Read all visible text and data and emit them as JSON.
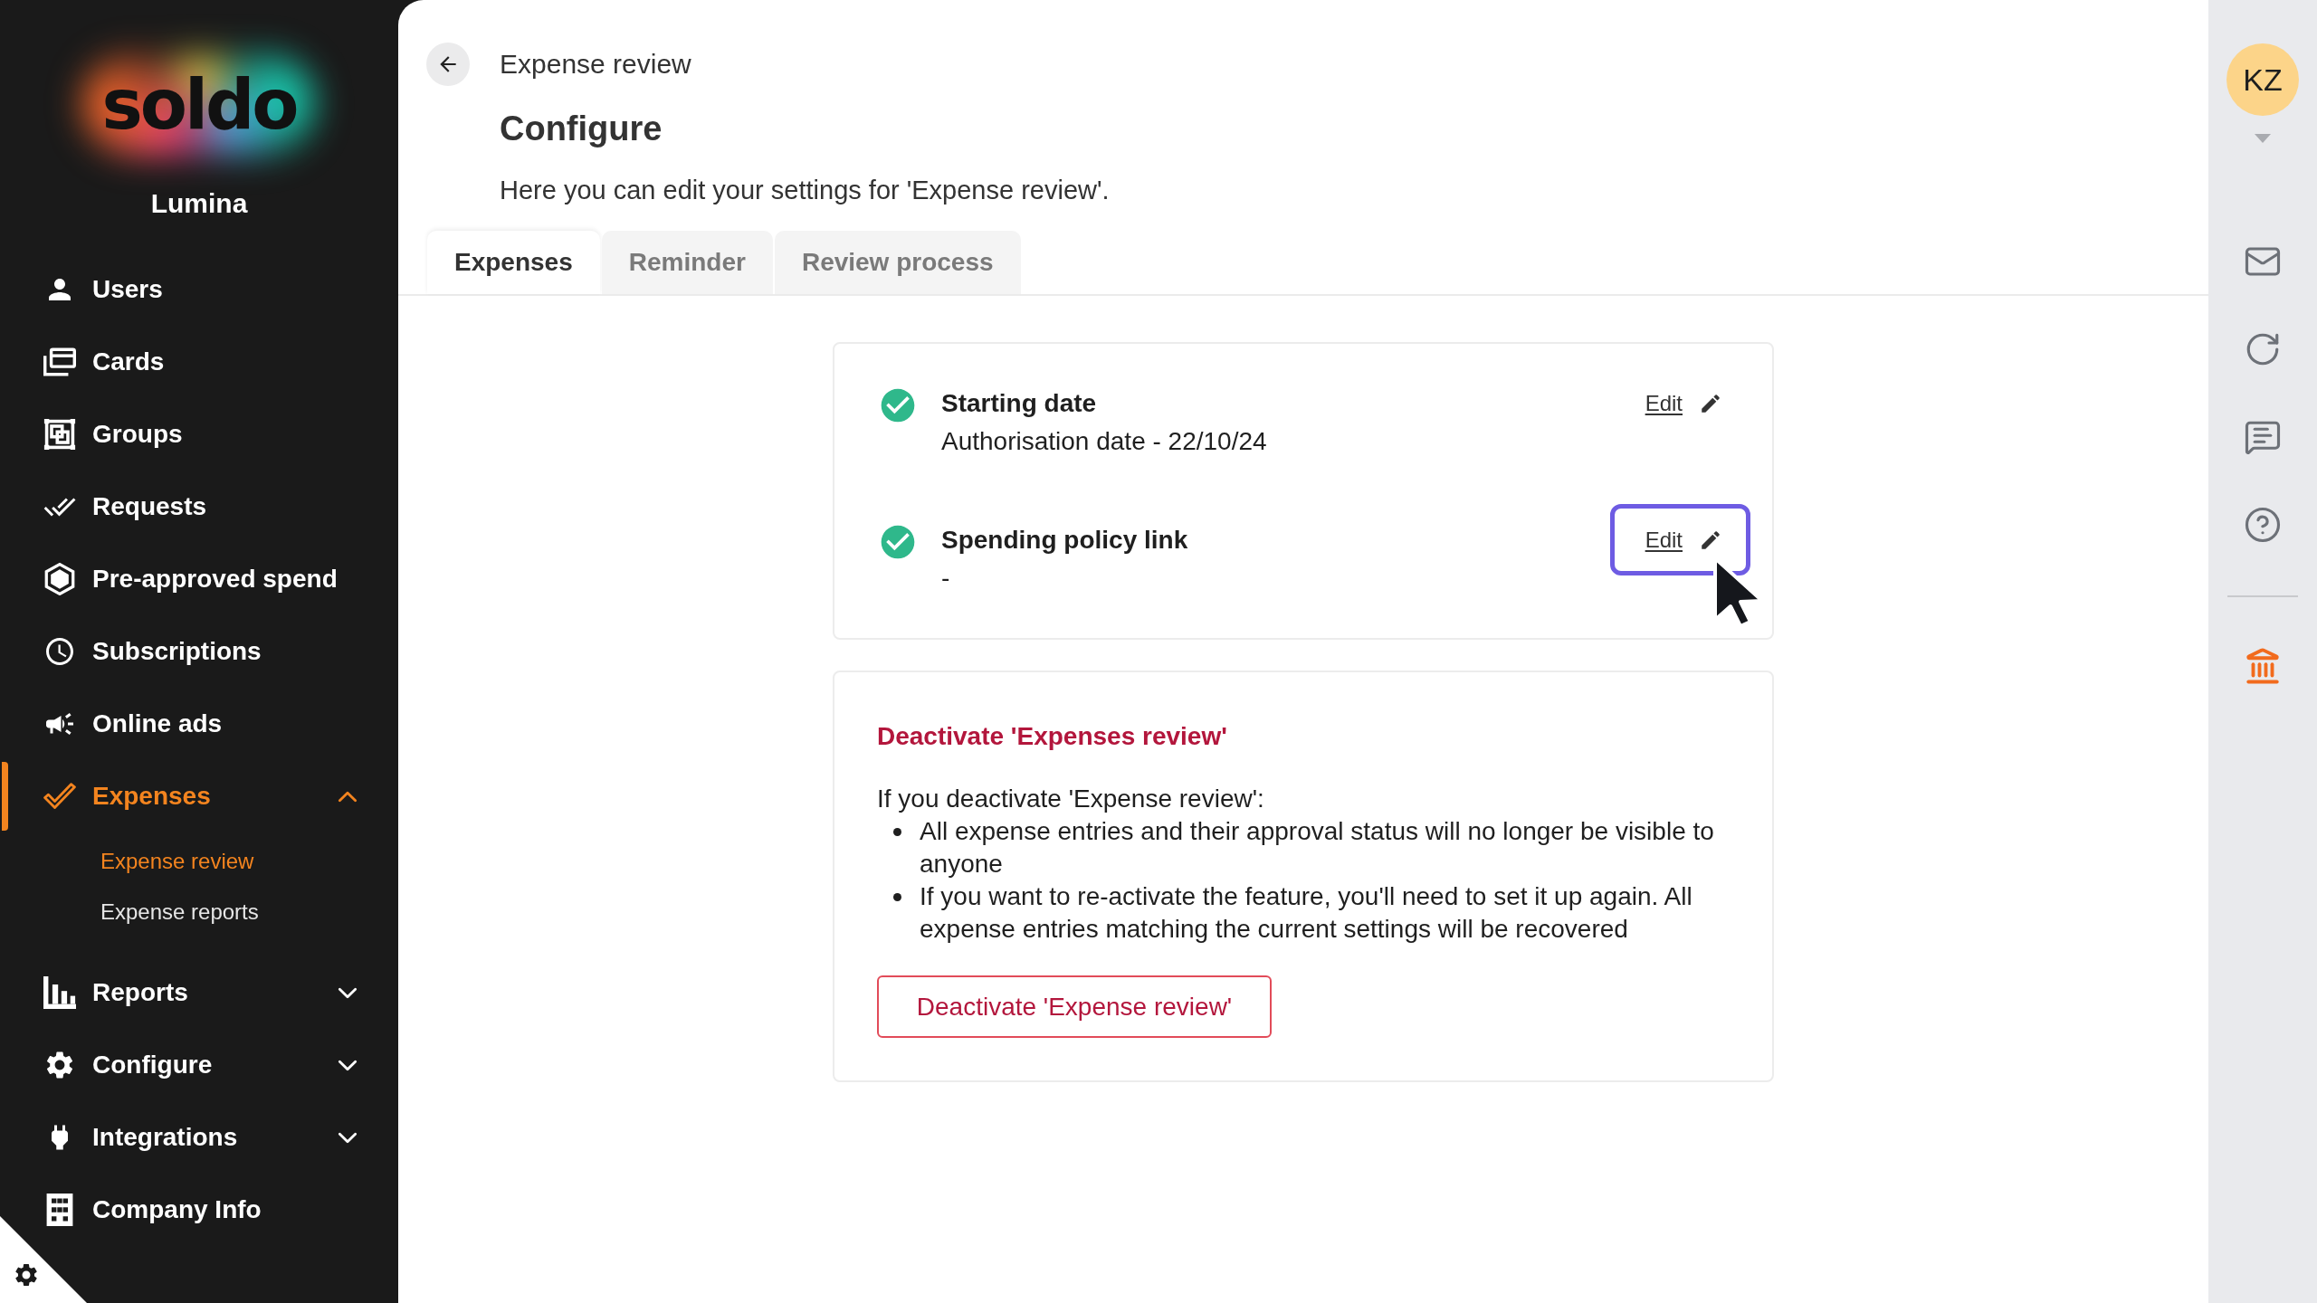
{
  "sidebar": {
    "logo": "soldo",
    "company": "Lumina",
    "items": [
      {
        "label": "Users",
        "kind": "link",
        "selected": false
      },
      {
        "label": "Cards",
        "kind": "link",
        "selected": false
      },
      {
        "label": "Groups",
        "kind": "link",
        "selected": false
      },
      {
        "label": "Requests",
        "kind": "link",
        "selected": false
      },
      {
        "label": "Pre-approved spend",
        "kind": "link",
        "selected": false
      },
      {
        "label": "Subscriptions",
        "kind": "link",
        "selected": false
      },
      {
        "label": "Online ads",
        "kind": "link",
        "selected": false
      },
      {
        "label": "Expenses",
        "kind": "group",
        "selected": true,
        "expanded": true,
        "children": [
          {
            "label": "Expense review",
            "selected": true
          },
          {
            "label": "Expense reports",
            "selected": false
          }
        ]
      },
      {
        "label": "Reports",
        "kind": "group",
        "selected": false,
        "expanded": false
      },
      {
        "label": "Configure",
        "kind": "group",
        "selected": false,
        "expanded": false
      },
      {
        "label": "Integrations",
        "kind": "group",
        "selected": false,
        "expanded": false
      },
      {
        "label": "Company Info",
        "kind": "link",
        "selected": false
      }
    ]
  },
  "header": {
    "breadcrumb": "Expense review",
    "title": "Configure",
    "description": "Here you can edit your settings for 'Expense review'."
  },
  "tabs": [
    {
      "label": "Expenses",
      "selected": true
    },
    {
      "label": "Reminder",
      "selected": false
    },
    {
      "label": "Review process",
      "selected": false
    }
  ],
  "settings": [
    {
      "title": "Starting date",
      "value": "Authorisation date - 22/10/24",
      "done": true,
      "action": "Edit",
      "focused": false
    },
    {
      "title": "Spending policy link",
      "value": "-",
      "done": true,
      "action": "Edit",
      "focused": true
    }
  ],
  "deactivate": {
    "title": "Deactivate 'Expenses review'",
    "intro": "If you deactivate 'Expense review':",
    "bullets": [
      "All expense entries and their approval status will no longer be visible to anyone",
      "If you want to re-activate the feature, you'll need to set it up again. All expense entries matching the current settings will be recovered"
    ],
    "button": "Deactivate 'Expense review'"
  },
  "user": {
    "initials": "KZ"
  }
}
